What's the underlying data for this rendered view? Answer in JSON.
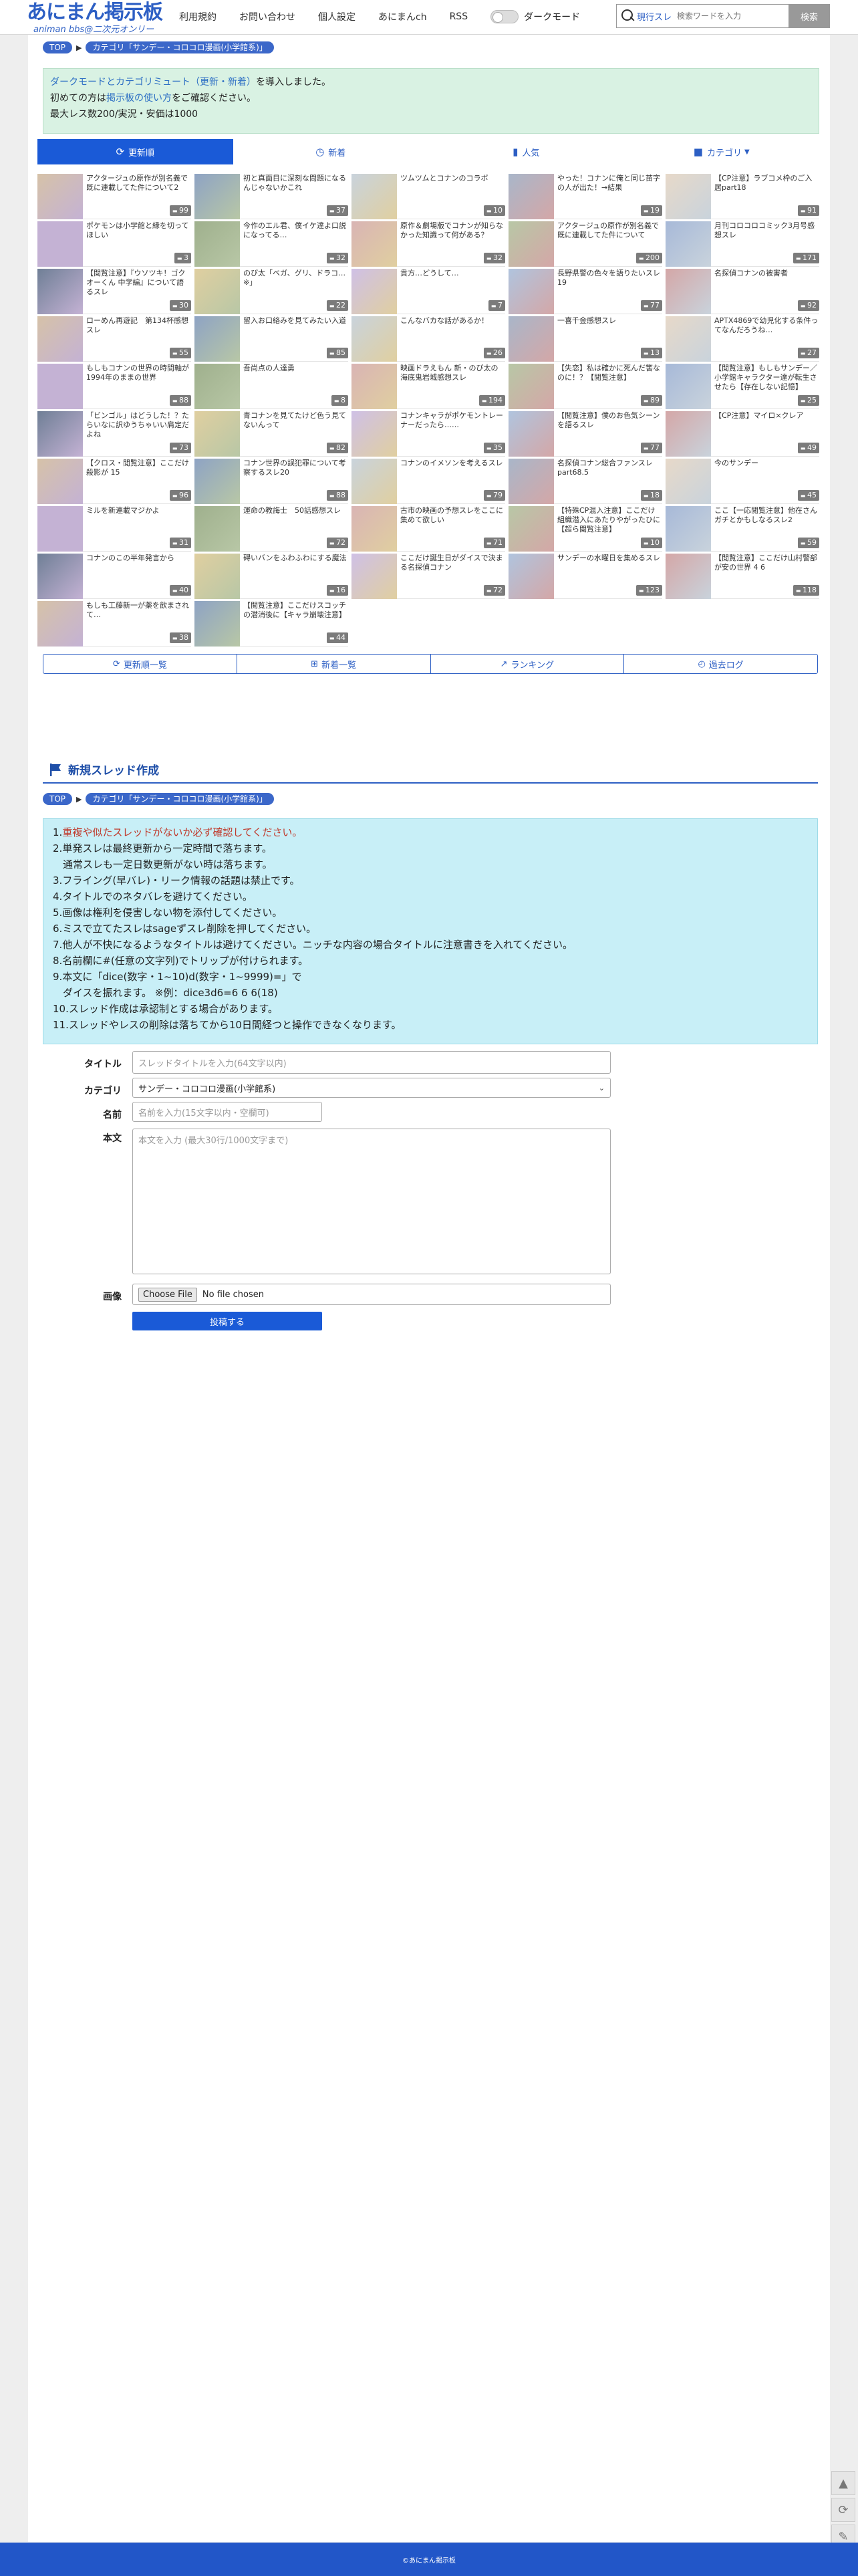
{
  "header": {
    "logo_main": "あにまん掲示板",
    "logo_sub": "animan bbs@二次元オンリー",
    "nav": [
      "利用規約",
      "お問い合わせ",
      "個人設定",
      "あにまんch",
      "RSS"
    ],
    "dark_mode_label": "ダークモード",
    "search_scope": "現行スレ",
    "search_placeholder": "検索ワードを入力",
    "search_button": "検索"
  },
  "breadcrumb": {
    "top": "TOP",
    "category": "カテゴリ「サンデー・コロコロ漫画(小学館系)」"
  },
  "notice": {
    "line1_link": "ダークモードとカテゴリミュート（更新・新着）",
    "line1_text": "を導入しました。",
    "line2_pre": "初めての方は",
    "line2_link": "掲示板の使い方",
    "line2_post": "をご確認ください。",
    "line3": "最大レス数200/実況・安価は1000"
  },
  "tabs": [
    {
      "label": "更新順",
      "icon": "refresh-icon"
    },
    {
      "label": "新着",
      "icon": "clock-icon"
    },
    {
      "label": "人気",
      "icon": "bar-chart-icon"
    },
    {
      "label": "カテゴリ",
      "icon": "folder-icon"
    }
  ],
  "threads": [
    {
      "title": "アクタージュの原作が別名義で既に連載してた件について2",
      "count": "99"
    },
    {
      "title": "初と真面目に深刻な問題になるんじゃないかこれ",
      "count": "37"
    },
    {
      "title": "ツムツムとコナンのコラボ",
      "count": "10"
    },
    {
      "title": "やった！コナンに俺と同じ苗字の人が出た！→結果",
      "count": "19"
    },
    {
      "title": "【CP注意】ラブコメ枠のご入居part18",
      "count": "91"
    },
    {
      "title": "ポケモンは小学館と縁を切ってほしい",
      "count": "3"
    },
    {
      "title": "今作のエル君、僕イケ達よ口説になってる…",
      "count": "32"
    },
    {
      "title": "原作＆劇場版でコナンが知らなかった知識って何がある？",
      "count": "32"
    },
    {
      "title": "アクタージュの原作が別名義で既に連載してた件について",
      "count": "200"
    },
    {
      "title": "月刊コロコロコミック3月号感想スレ",
      "count": "171"
    },
    {
      "title": "【閲覧注意】『ウソツキ！ゴクオーくん 中学編』について語るスレ",
      "count": "30"
    },
    {
      "title": "のび太「ベガ、グリ、ドラコ…※」",
      "count": "22"
    },
    {
      "title": "貴方…どうして…",
      "count": "7"
    },
    {
      "title": "長野県警の色々を語りたいスレ19",
      "count": "77"
    },
    {
      "title": "名探偵コナンの被害者",
      "count": "92"
    },
    {
      "title": "ローめん再遊記　第134杯感想スレ",
      "count": "55"
    },
    {
      "title": "留入お口絡みを見てみたい入道",
      "count": "85"
    },
    {
      "title": "こんなバカな話があるか！",
      "count": "26"
    },
    {
      "title": "一喜千金感想スレ",
      "count": "13"
    },
    {
      "title": "APTX4869で幼児化する条件ってなんだろうね…",
      "count": "27"
    },
    {
      "title": "もしもコナンの世界の時間軸が1994年のままの世界",
      "count": "88"
    },
    {
      "title": "吾尚点の人達勇",
      "count": "8"
    },
    {
      "title": "映画ドラえもん 新・のび太の海底鬼岩城感想スレ",
      "count": "194"
    },
    {
      "title": "【失恋】私は確かに死んだ筈なのに！？【閲覧注意】",
      "count": "89"
    },
    {
      "title": "【閲覧注意】もしもサンデー／小学館キャラクター達が転生させたら【存在しない記憶】",
      "count": "25"
    },
    {
      "title": "「ビンゴル」はどうした！？たらいなに訳ゆうちゃいい肩定だよね",
      "count": "73"
    },
    {
      "title": "青コナンを見てたけど色う見てないんって",
      "count": "82"
    },
    {
      "title": "コナンキャラがポケモントレーナーだったら……",
      "count": "35"
    },
    {
      "title": "【閲覧注意】僕のお色気シーンを語るスレ",
      "count": "77"
    },
    {
      "title": "【CP注意】マイロ×クレア",
      "count": "49"
    },
    {
      "title": "【クロス・閲覧注意】ここだけ殺影が 15",
      "count": "96"
    },
    {
      "title": "コナン世界の誤犯罪について考察するスレ20",
      "count": "88"
    },
    {
      "title": "コナンのイメソンを考えるスレ",
      "count": "79"
    },
    {
      "title": "名探偵コナン総合ファンスレpart68.5",
      "count": "18"
    },
    {
      "title": "今のサンデー",
      "count": "45"
    },
    {
      "title": "ミルを新連載マジかよ",
      "count": "31"
    },
    {
      "title": "運命の教誨士　50話感想スレ",
      "count": "72"
    },
    {
      "title": "古市の映画の予想スレをここに集めて欲しい",
      "count": "71"
    },
    {
      "title": "【特殊CP混入注意】ここだけ組織潜入にあたりやがったひに【超ら閲覧注意】",
      "count": "10"
    },
    {
      "title": "ここ【一応閲覧注意】他在さんガチとかもしなるスレ2",
      "count": "59"
    },
    {
      "title": "コナンのこの半年発言から",
      "count": "40"
    },
    {
      "title": "碍いバンをふわふわにする魔法",
      "count": "16"
    },
    {
      "title": "ここだけ誕生日がダイスで決まる名探偵コナン",
      "count": "72"
    },
    {
      "title": "サンデーの水曜日を集めるスレ",
      "count": "123"
    },
    {
      "title": "【閲覧注意】ここだけ山村警部が安の世界 4 6",
      "count": "118"
    },
    {
      "title": "もしも工藤新一が薬を飲まされて…",
      "count": "38"
    },
    {
      "title": "【閲覧注意】ここだけスコッチの潜消後に【キャラ崩壊注意】",
      "count": "44"
    }
  ],
  "bottom_links": [
    {
      "label": "更新順一覧",
      "icon": "refresh-icon"
    },
    {
      "label": "新着一覧",
      "icon": "plus-square-icon"
    },
    {
      "label": "ランキング",
      "icon": "line-chart-icon"
    },
    {
      "label": "過去ログ",
      "icon": "history-icon"
    }
  ],
  "new_thread": {
    "title": "新規スレッド作成",
    "rules": [
      {
        "num": "1.",
        "text": "重複や似たスレッドがないか必ず確認してください。",
        "red": true
      },
      {
        "num": "2.",
        "text": "単発スレは最終更新から一定時間で落ちます。",
        "red": false
      },
      {
        "num": "",
        "text": "　通常スレも一定日数更新がない時は落ちます。",
        "red": false
      },
      {
        "num": "3.",
        "text": "フライング(早バレ)・リーク情報の話題は禁止です。",
        "red": false
      },
      {
        "num": "4.",
        "text": "タイトルでのネタバレを避けてください。",
        "red": false
      },
      {
        "num": "5.",
        "text": "画像は権利を侵害しない物を添付してください。",
        "red": false
      },
      {
        "num": "6.",
        "text": "ミスで立てたスレはsageずスレ削除を押してください。",
        "red": false
      },
      {
        "num": "7.",
        "text": "他人が不快になるようなタイトルは避けてください。ニッチな内容の場合タイトルに注意書きを入れてください。",
        "red": false
      },
      {
        "num": "8.",
        "text": "名前欄に#(任意の文字列)でトリップが付けられます。",
        "red": false
      },
      {
        "num": "9.",
        "text": "本文に「dice(数字・1~10)d(数字・1~9999)=」で",
        "red": false
      },
      {
        "num": "",
        "text": "　ダイスを振れます。 ※例：dice3d6=6 6 6(18)",
        "red": false
      },
      {
        "num": "10.",
        "text": "スレッド作成は承認制とする場合があります。",
        "red": false
      },
      {
        "num": "11.",
        "text": "スレッドやレスの削除は落ちてから10日間経つと操作できなくなります。",
        "red": false
      }
    ],
    "form": {
      "title_label": "タイトル",
      "title_placeholder": "スレッドタイトルを入力(64文字以内)",
      "category_label": "カテゴリ",
      "category_value": "サンデー・コロコロ漫画(小学館系)",
      "name_label": "名前",
      "name_placeholder": "名前を入力(15文字以内・空欄可)",
      "body_label": "本文",
      "body_placeholder": "本文を入力 (最大30行/1000文字まで)",
      "image_label": "画像",
      "file_button": "Choose File",
      "file_status": "No file chosen",
      "submit": "投稿する"
    }
  },
  "footer": {
    "copyright": "©あにまん掲示板"
  },
  "colors": {
    "accent": "#1a5ad7",
    "brand": "#2d5fc4",
    "notice_bg": "#d9f2e3",
    "rules_bg": "#c8eff7",
    "count_badge": "#7b7b7b",
    "warning": "#c0392b"
  }
}
